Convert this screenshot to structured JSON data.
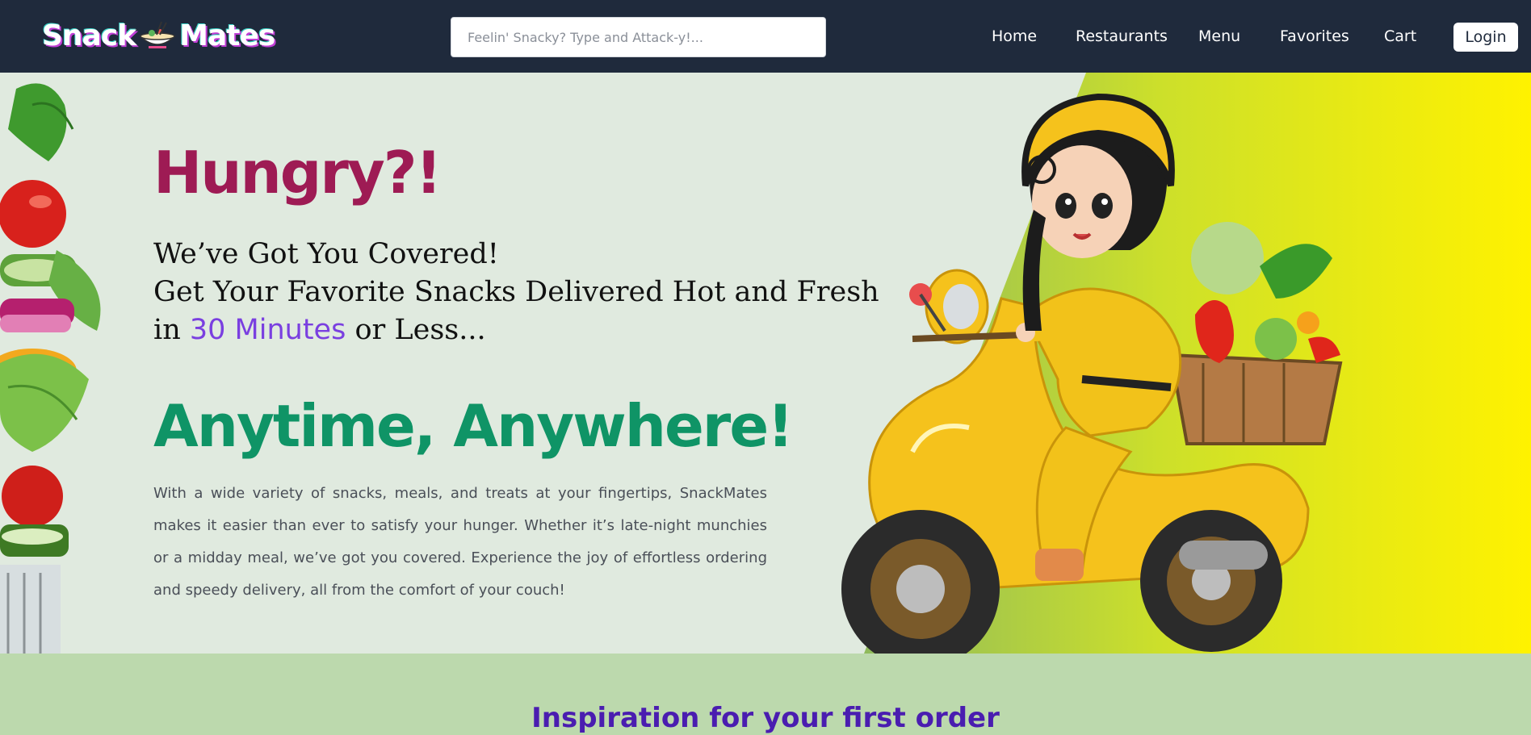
{
  "nav": {
    "logo_left": "Snack",
    "logo_right": "Mates",
    "search_placeholder": "Feelin' Snacky? Type and Attack-y!...",
    "links": [
      "Home",
      "Restaurants",
      "Menu",
      "Favorites",
      "Cart"
    ],
    "login_label": "Login"
  },
  "hero": {
    "headline": "Hungry?!",
    "tagline_line1": "We’ve Got You Covered!",
    "tagline_line2": "Get Your Favorite Snacks Delivered Hot and Fresh",
    "tagline_line3_pre": "in ",
    "tagline_highlight": "30 Minutes",
    "tagline_line3_post": " or Less...",
    "subheadline": "Anytime, Anywhere!",
    "description": "With a wide variety of snacks, meals, and treats at your fingertips, SnackMates makes it easier than ever to satisfy your hunger. Whether it’s late-night munchies or a midday meal, we’ve got you covered. Experience the joy of effortless ordering and speedy delivery, all from the comfort of your couch!"
  },
  "section": {
    "title": "Inspiration for your first order"
  },
  "colors": {
    "nav_bg": "#1f2a3c",
    "hero_bg": "#e0eadf",
    "headline": "#9e1b54",
    "highlight": "#7a3fe0",
    "subheadline": "#0f9466",
    "gradient_green": "#9bc25a",
    "gradient_yellow": "#fff200",
    "section_bg": "#bcd9ad",
    "section_title": "#4a1db0"
  },
  "icons": {
    "logo_bowl": "noodle-bowl-icon"
  }
}
